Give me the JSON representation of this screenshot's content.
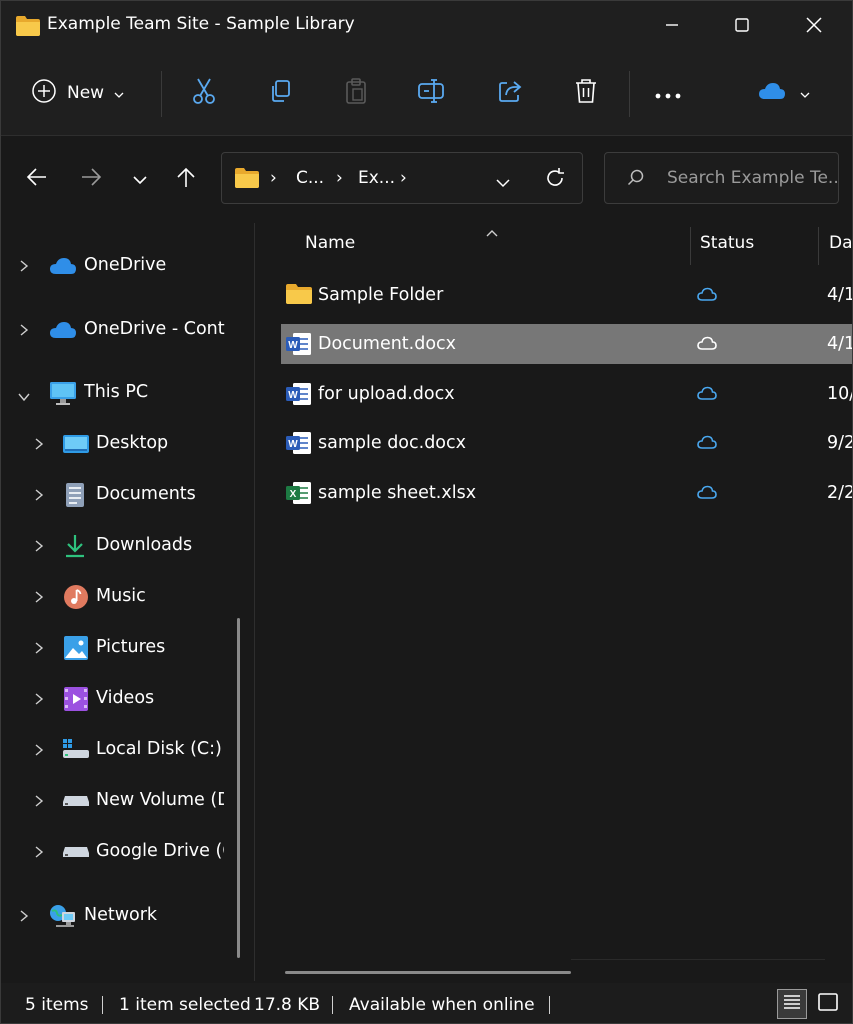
{
  "window": {
    "title": "Example Team Site - Sample Library"
  },
  "toolbar": {
    "new_label": "New"
  },
  "address": {
    "crumbs": [
      "C...",
      "Ex..."
    ]
  },
  "search": {
    "placeholder": "Search Example Te..."
  },
  "nav": {
    "items": [
      {
        "label": "OneDrive",
        "icon": "onedrive-cloud-icon"
      },
      {
        "label": "OneDrive - Conto",
        "icon": "onedrive-cloud-icon"
      },
      {
        "label": "This PC",
        "icon": "monitor-icon"
      },
      {
        "label": "Desktop",
        "icon": "desktop-icon"
      },
      {
        "label": "Documents",
        "icon": "documents-icon"
      },
      {
        "label": "Downloads",
        "icon": "download-arrow-icon"
      },
      {
        "label": "Music",
        "icon": "music-note-icon"
      },
      {
        "label": "Pictures",
        "icon": "picture-icon"
      },
      {
        "label": "Videos",
        "icon": "video-icon"
      },
      {
        "label": "Local Disk (C:)",
        "icon": "windows-drive-icon"
      },
      {
        "label": "New Volume (D:)",
        "icon": "drive-icon"
      },
      {
        "label": "Google Drive (G:)",
        "icon": "drive-icon"
      },
      {
        "label": "Network",
        "icon": "network-icon"
      }
    ]
  },
  "columns": {
    "name": "Name",
    "status": "Status",
    "date": "Date modified"
  },
  "files": [
    {
      "name": "Sample Folder",
      "type": "folder",
      "status": "cloud",
      "date": "4/1"
    },
    {
      "name": "Document.docx",
      "type": "word",
      "status": "cloud",
      "date": "4/1",
      "selected": true
    },
    {
      "name": "for upload.docx",
      "type": "word",
      "status": "cloud",
      "date": "10/"
    },
    {
      "name": "sample doc.docx",
      "type": "word",
      "status": "cloud",
      "date": "9/2"
    },
    {
      "name": "sample sheet.xlsx",
      "type": "excel",
      "status": "cloud",
      "date": "2/2"
    }
  ],
  "statusbar": {
    "count": "5 items",
    "selected": "1 item selected",
    "size": "17.8 KB",
    "availability": "Available when online"
  },
  "colors": {
    "accent": "#0f78d4",
    "folder": "#f5c044",
    "word": "#2b5cb8",
    "excel": "#1d7a43",
    "selected_row": "#777777"
  }
}
